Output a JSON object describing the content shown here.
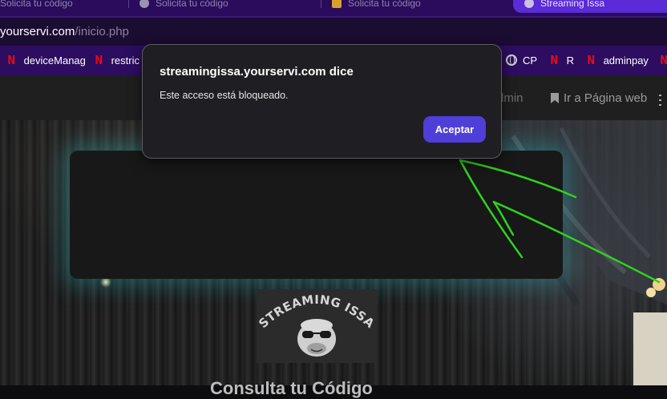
{
  "tabs": [
    {
      "label": "Solicita tu código",
      "active": false
    },
    {
      "label": "Solicita tu código",
      "active": false
    },
    {
      "label": "Solicita tu código",
      "active": false
    },
    {
      "label": "Streaming Issa",
      "active": true
    }
  ],
  "address": {
    "host": "yourservi.com",
    "path": "/inicio.php"
  },
  "bookmarks": [
    {
      "label": "deviceManag",
      "icon": "netflix-icon"
    },
    {
      "label": "restric v",
      "icon": "netflix-icon"
    },
    {
      "label": "CP",
      "icon": "globe-icon"
    },
    {
      "label": "R",
      "icon": "netflix-icon"
    },
    {
      "label": "adminpay",
      "icon": "netflix-icon"
    }
  ],
  "site_nav": {
    "admin": "dmin",
    "web": "Ir a Página web"
  },
  "logo": {
    "line": "STREAMING ISSA"
  },
  "card": {
    "heading": "Consulta tu Código"
  },
  "dialog": {
    "title": "streamingissa.yourservi.com dice",
    "message": "Este acceso está bloqueado.",
    "button": "Aceptar"
  },
  "colors": {
    "accent": "#4f3ed8",
    "annotation": "#2fd21e",
    "tab_strip": "#2a0b5c",
    "card_glow": "#28bec8"
  }
}
